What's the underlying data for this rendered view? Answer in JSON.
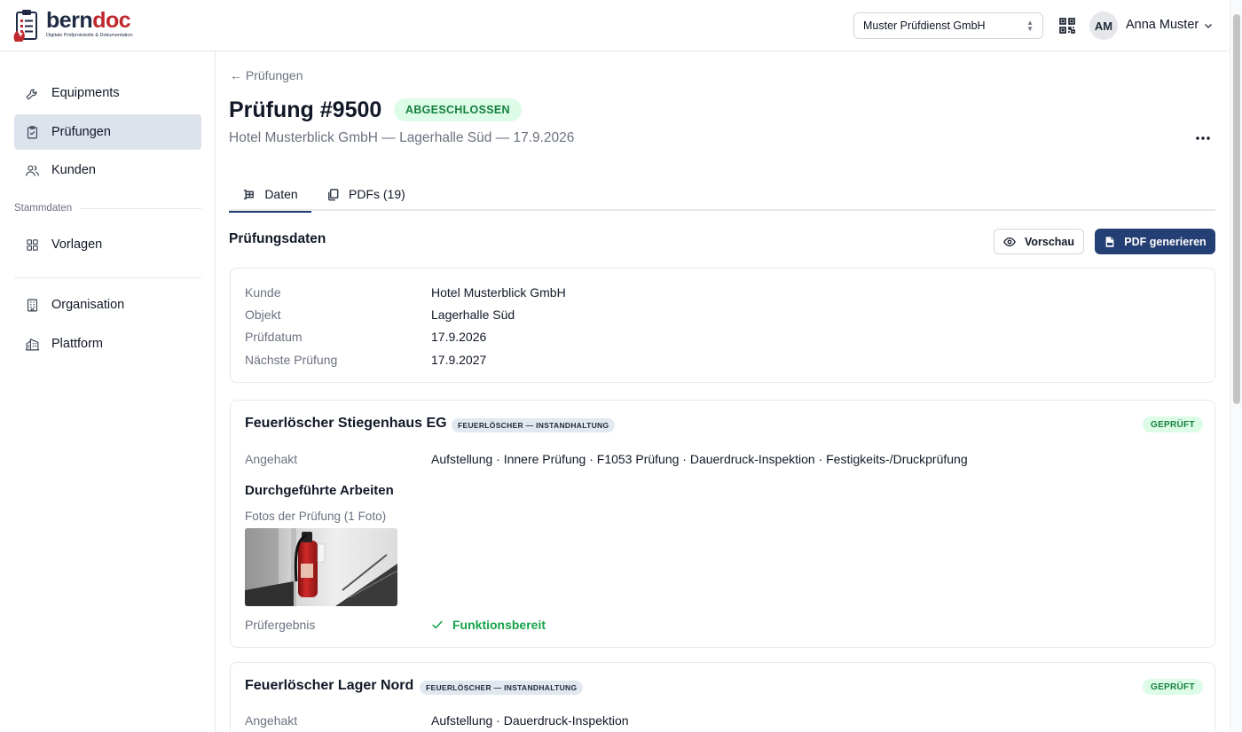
{
  "header": {
    "logo": {
      "brand_a": "bern",
      "brand_b": "doc",
      "tagline": "Digitale Prüfprotokolle & Dokumentation"
    },
    "org_select": {
      "value": "Muster Prüfdienst GmbH"
    },
    "qr_icon": "qr-code-icon",
    "user": {
      "initials": "AM",
      "name": "Anna Muster"
    }
  },
  "sidebar": {
    "items": [
      {
        "label": "Equipments",
        "icon": "wrench-icon"
      },
      {
        "label": "Prüfungen",
        "icon": "clipboard-check-icon",
        "active": true
      },
      {
        "label": "Kunden",
        "icon": "users-icon"
      }
    ],
    "section_label": "Stammdaten",
    "master_items": [
      {
        "label": "Vorlagen",
        "icon": "grid-icon"
      }
    ],
    "admin_items": [
      {
        "label": "Organisation",
        "icon": "building-icon"
      },
      {
        "label": "Plattform",
        "icon": "buildings-icon"
      }
    ]
  },
  "page": {
    "back": "← Prüfungen",
    "title": "Prüfung #9500",
    "status": "ABGESCHLOSSEN",
    "subtitle": "Hotel Musterblick GmbH — Lagerhalle Süd — 17.9.2026"
  },
  "tabs": [
    {
      "label": "Daten",
      "active": true
    },
    {
      "label": "PDFs (19)"
    }
  ],
  "section": {
    "title": "Prüfungsdaten",
    "preview_label": "Vorschau",
    "pdf_label": "PDF generieren"
  },
  "details": [
    {
      "label": "Kunde",
      "value": "Hotel Musterblick GmbH"
    },
    {
      "label": "Objekt",
      "value": "Lagerhalle Süd"
    },
    {
      "label": "Prüfdatum",
      "value": "17.9.2026"
    },
    {
      "label": "Nächste Prüfung",
      "value": "17.9.2027"
    }
  ],
  "items": [
    {
      "title": "Feuerlöscher Stiegenhaus EG",
      "category": "FEUERLÖSCHER — INSTANDHALTUNG",
      "status": "GEPRÜFT",
      "checked_label": "Angehakt",
      "checked_value": "Aufstellung · Innere Prüfung · F1053 Prüfung · Dauerdruck-Inspektion · Festigkeits-/Druckprüfung",
      "work_title": "Durchgeführte Arbeiten",
      "photos_label": "Fotos der Prüfung (1 Foto)",
      "result_label": "Prüfergebnis",
      "result_value": "Funktionsbereit"
    },
    {
      "title": "Feuerlöscher Lager Nord",
      "category": "FEUERLÖSCHER — INSTANDHALTUNG",
      "status": "GEPRÜFT",
      "checked_label": "Angehakt",
      "checked_value": "Aufstellung · Dauerdruck-Inspektion"
    }
  ],
  "colors": {
    "accent": "#243f73",
    "success_bg": "#dcfce7",
    "success_text": "#15803d",
    "active_nav": "#dde3ec"
  }
}
